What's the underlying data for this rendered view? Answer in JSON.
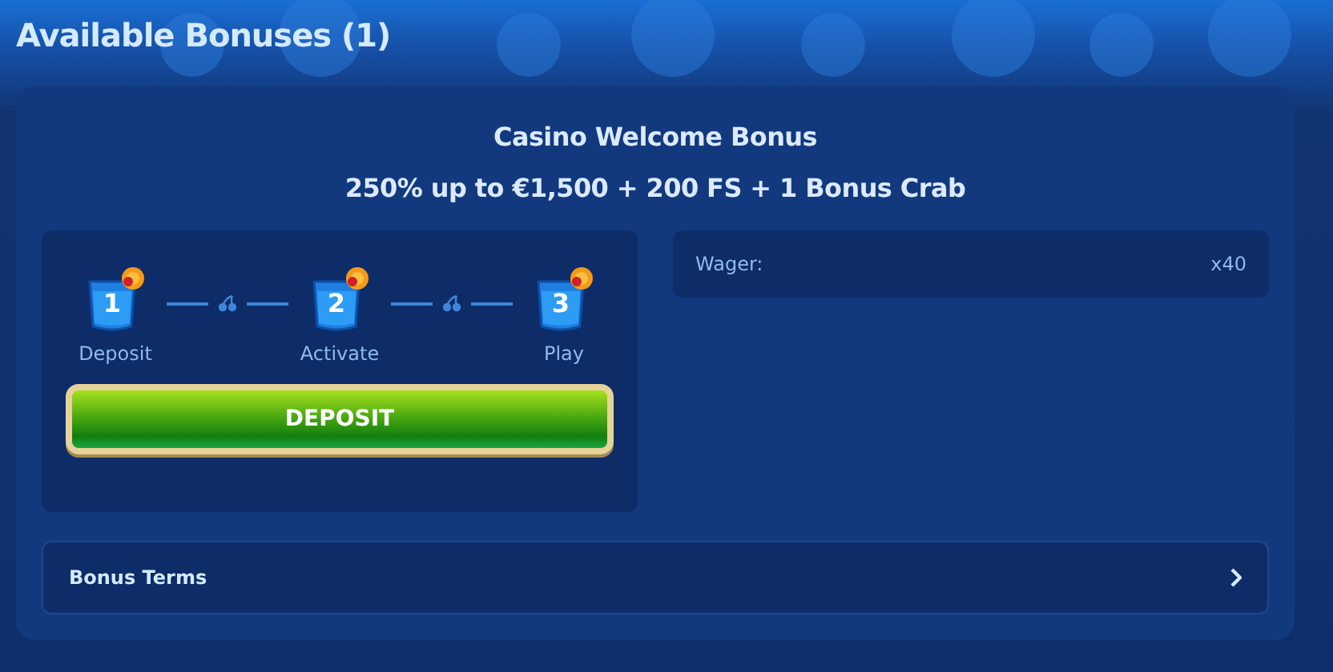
{
  "page_title": "Available Bonuses (1)",
  "bonus": {
    "title": "Casino Welcome Bonus",
    "subtitle": "250% up to €1,500 + 200 FS + 1 Bonus Crab",
    "steps": [
      {
        "number": "1",
        "label": "Deposit"
      },
      {
        "number": "2",
        "label": "Activate"
      },
      {
        "number": "3",
        "label": "Play"
      }
    ],
    "action": "DEPOSIT",
    "details": [
      {
        "label": "Wager:",
        "value": "x40"
      }
    ],
    "terms": "Bonus Terms"
  }
}
